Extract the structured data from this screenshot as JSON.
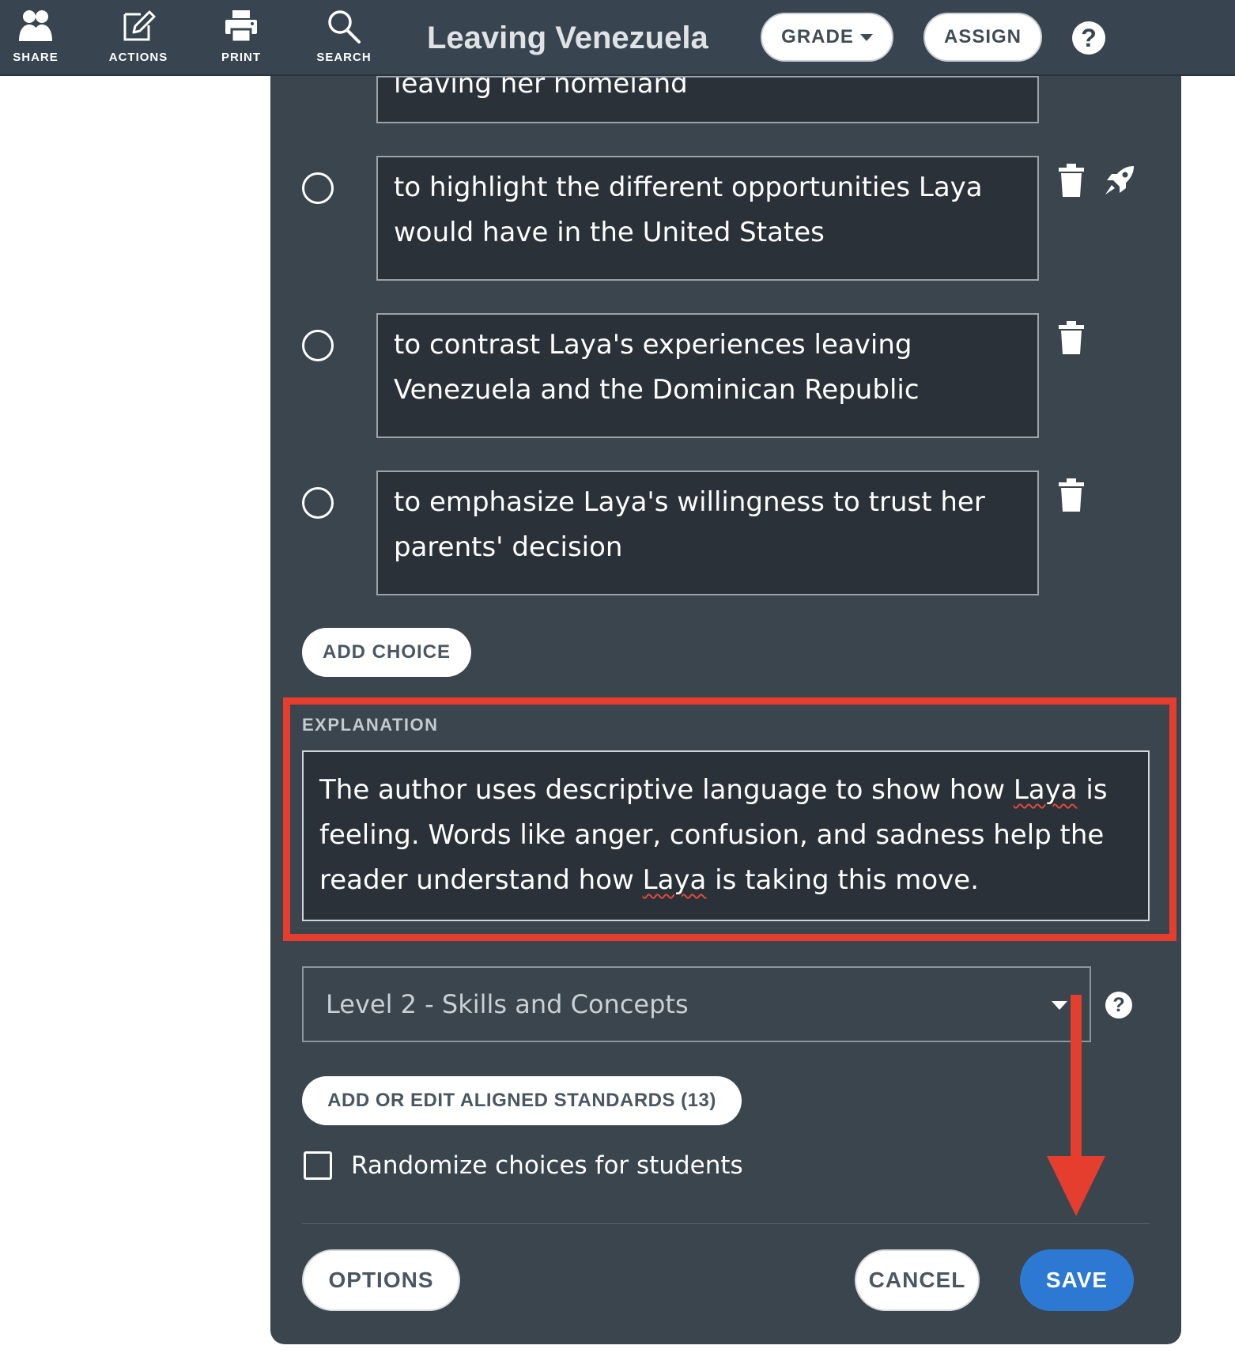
{
  "toolbar": {
    "tools": [
      {
        "label": "SHARE",
        "icon": "users-icon"
      },
      {
        "label": "ACTIONS",
        "icon": "edit-icon"
      },
      {
        "label": "PRINT",
        "icon": "printer-icon"
      },
      {
        "label": "SEARCH",
        "icon": "search-icon"
      }
    ],
    "title": "Leaving Venezuela",
    "grade_label": "GRADE",
    "assign_label": "ASSIGN",
    "help_label": "?"
  },
  "question": {
    "choices": [
      {
        "text": "leaving her homeland"
      },
      {
        "text": "to highlight the different opportunities Laya would have in the United States"
      },
      {
        "text": "to contrast Laya's experiences leaving Venezuela and the Dominican Republic"
      },
      {
        "text": "to emphasize Laya's willingness to trust her parents' decision"
      }
    ],
    "add_choice_label": "ADD CHOICE",
    "explanation_label": "EXPLANATION",
    "explanation": {
      "part1": "The author uses descriptive language to show how ",
      "flagged1": "Laya",
      "part2": " is feeling. Words like anger, confusion, and sadness help the reader understand how ",
      "flagged2": "Laya",
      "part3": " is taking this move."
    },
    "level_value": "Level 2 - Skills and Concepts",
    "level_help": "?",
    "standards_label": "ADD OR EDIT ALIGNED STANDARDS (13)",
    "randomize_label": "Randomize choices for students",
    "randomize_checked": false
  },
  "footer": {
    "options_label": "OPTIONS",
    "cancel_label": "CANCEL",
    "save_label": "SAVE"
  },
  "colors": {
    "toolbar_bg": "#38444f",
    "panel_bg": "#3a454e",
    "field_bg": "#2a3138",
    "highlight": "#e53d2e",
    "save_bg": "#2d78d2"
  }
}
